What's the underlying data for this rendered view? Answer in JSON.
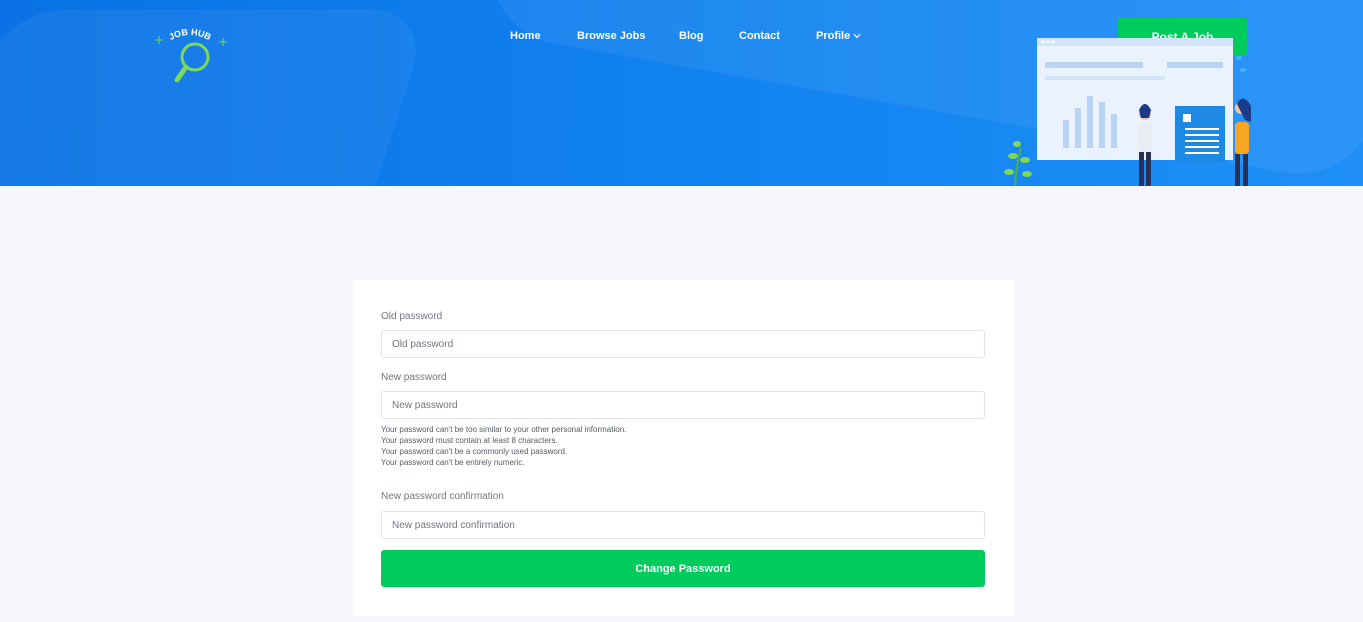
{
  "header": {
    "logo_text": "JOB HUB",
    "nav": {
      "home": "Home",
      "browse_jobs": "Browse Jobs",
      "blog": "Blog",
      "contact": "Contact",
      "profile": "Profile"
    },
    "post_job_label": "Post A Job",
    "colors": {
      "header_blue": "#0a72e4",
      "accent_green": "#00cc5e",
      "logo_green": "#7ed957"
    }
  },
  "form": {
    "old_password": {
      "label": "Old password",
      "placeholder": "Old password"
    },
    "new_password": {
      "label": "New password",
      "placeholder": "New password"
    },
    "help_text": [
      "Your password can't be too similar to your other personal information.",
      "Your password must contain at least 8 characters.",
      "Your password can't be a commonly used password.",
      "Your password can't be entirely numeric."
    ],
    "confirm_password": {
      "label": "New password confirmation",
      "placeholder": "New password confirmation"
    },
    "submit_label": "Change Password"
  }
}
